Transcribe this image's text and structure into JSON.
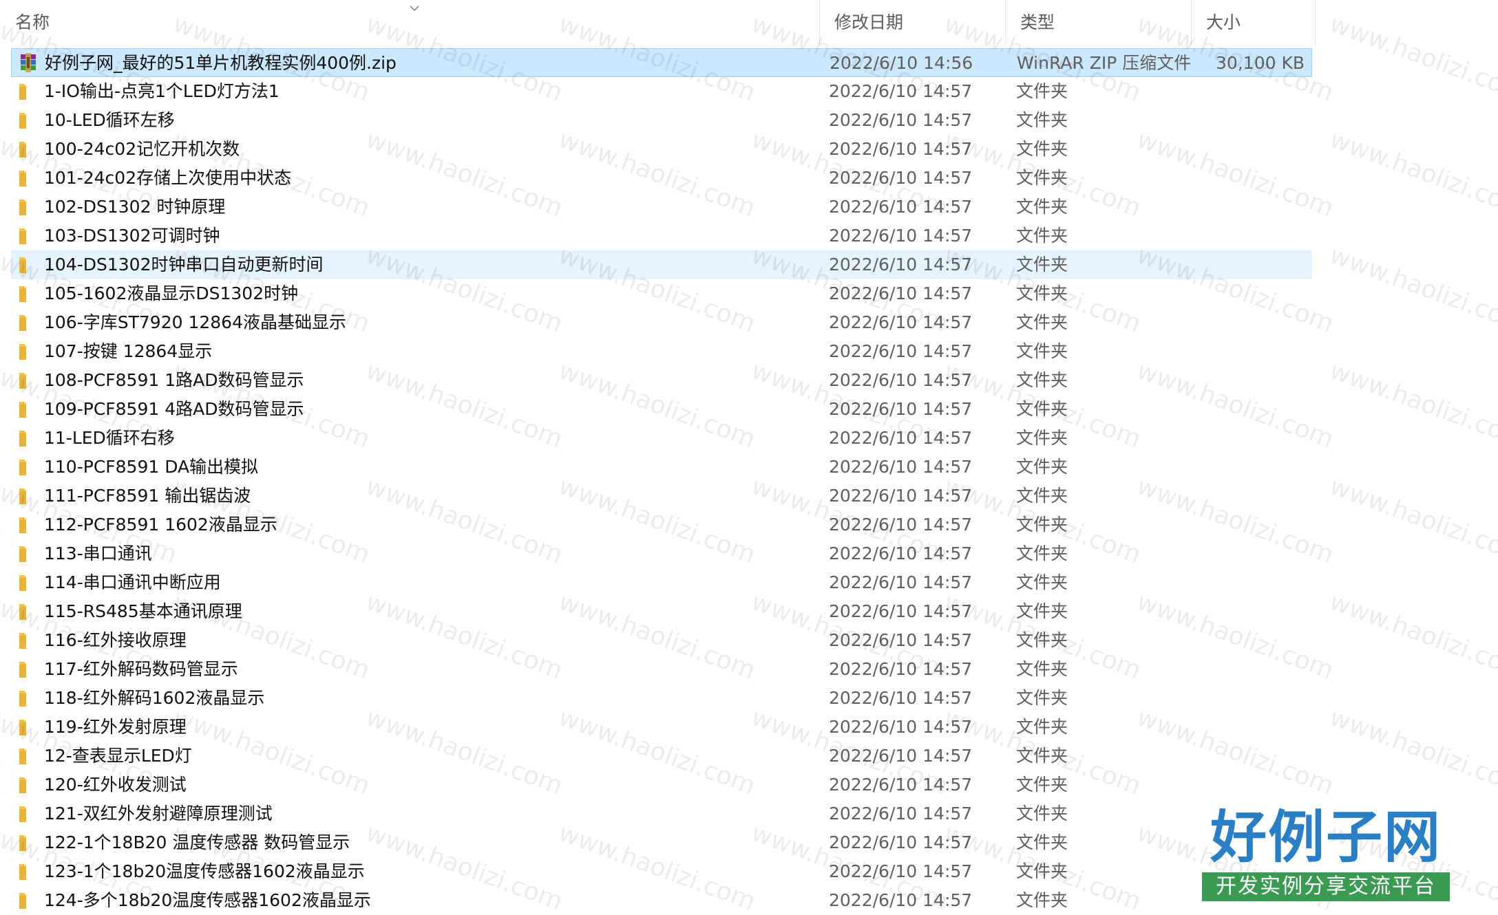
{
  "columns": {
    "name": "名称",
    "date": "修改日期",
    "type": "类型",
    "size": "大小"
  },
  "watermark": "www.haolizi.com",
  "logo": {
    "title": "好例子网",
    "subtitle": "开发实例分享交流平台"
  },
  "colors": {
    "selected_bg": "#cce8ff",
    "hover_bg": "#e5f3ff",
    "folder": "#f2c14e",
    "logo_blue": "#2a7fc4",
    "logo_green": "#3a9a52"
  },
  "files": [
    {
      "name": "好例子网_最好的51单片机教程实例400例.zip",
      "date": "2022/6/10 14:56",
      "type": "WinRAR ZIP 压缩文件",
      "size": "30,100 KB",
      "icon": "winrar-zip-icon",
      "state": "selected"
    },
    {
      "name": "1-IO输出-点亮1个LED灯方法1",
      "date": "2022/6/10 14:57",
      "type": "文件夹",
      "size": "",
      "icon": "folder-icon",
      "state": ""
    },
    {
      "name": "10-LED循环左移",
      "date": "2022/6/10 14:57",
      "type": "文件夹",
      "size": "",
      "icon": "folder-icon",
      "state": ""
    },
    {
      "name": "100-24c02记忆开机次数",
      "date": "2022/6/10 14:57",
      "type": "文件夹",
      "size": "",
      "icon": "folder-icon",
      "state": ""
    },
    {
      "name": "101-24c02存储上次使用中状态",
      "date": "2022/6/10 14:57",
      "type": "文件夹",
      "size": "",
      "icon": "folder-icon",
      "state": ""
    },
    {
      "name": "102-DS1302 时钟原理",
      "date": "2022/6/10 14:57",
      "type": "文件夹",
      "size": "",
      "icon": "folder-icon",
      "state": ""
    },
    {
      "name": "103-DS1302可调时钟",
      "date": "2022/6/10 14:57",
      "type": "文件夹",
      "size": "",
      "icon": "folder-icon",
      "state": ""
    },
    {
      "name": "104-DS1302时钟串口自动更新时间",
      "date": "2022/6/10 14:57",
      "type": "文件夹",
      "size": "",
      "icon": "folder-icon",
      "state": "hover"
    },
    {
      "name": "105-1602液晶显示DS1302时钟",
      "date": "2022/6/10 14:57",
      "type": "文件夹",
      "size": "",
      "icon": "folder-icon",
      "state": ""
    },
    {
      "name": "106-字库ST7920 12864液晶基础显示",
      "date": "2022/6/10 14:57",
      "type": "文件夹",
      "size": "",
      "icon": "folder-icon",
      "state": ""
    },
    {
      "name": "107-按键 12864显示",
      "date": "2022/6/10 14:57",
      "type": "文件夹",
      "size": "",
      "icon": "folder-icon",
      "state": ""
    },
    {
      "name": "108-PCF8591 1路AD数码管显示",
      "date": "2022/6/10 14:57",
      "type": "文件夹",
      "size": "",
      "icon": "folder-icon",
      "state": ""
    },
    {
      "name": "109-PCF8591 4路AD数码管显示",
      "date": "2022/6/10 14:57",
      "type": "文件夹",
      "size": "",
      "icon": "folder-icon",
      "state": ""
    },
    {
      "name": "11-LED循环右移",
      "date": "2022/6/10 14:57",
      "type": "文件夹",
      "size": "",
      "icon": "folder-icon",
      "state": ""
    },
    {
      "name": "110-PCF8591 DA输出模拟",
      "date": "2022/6/10 14:57",
      "type": "文件夹",
      "size": "",
      "icon": "folder-icon",
      "state": ""
    },
    {
      "name": "111-PCF8591 输出锯齿波",
      "date": "2022/6/10 14:57",
      "type": "文件夹",
      "size": "",
      "icon": "folder-icon",
      "state": ""
    },
    {
      "name": "112-PCF8591 1602液晶显示",
      "date": "2022/6/10 14:57",
      "type": "文件夹",
      "size": "",
      "icon": "folder-icon",
      "state": ""
    },
    {
      "name": "113-串口通讯",
      "date": "2022/6/10 14:57",
      "type": "文件夹",
      "size": "",
      "icon": "folder-icon",
      "state": ""
    },
    {
      "name": "114-串口通讯中断应用",
      "date": "2022/6/10 14:57",
      "type": "文件夹",
      "size": "",
      "icon": "folder-icon",
      "state": ""
    },
    {
      "name": "115-RS485基本通讯原理",
      "date": "2022/6/10 14:57",
      "type": "文件夹",
      "size": "",
      "icon": "folder-icon",
      "state": ""
    },
    {
      "name": "116-红外接收原理",
      "date": "2022/6/10 14:57",
      "type": "文件夹",
      "size": "",
      "icon": "folder-icon",
      "state": ""
    },
    {
      "name": "117-红外解码数码管显示",
      "date": "2022/6/10 14:57",
      "type": "文件夹",
      "size": "",
      "icon": "folder-icon",
      "state": ""
    },
    {
      "name": "118-红外解码1602液晶显示",
      "date": "2022/6/10 14:57",
      "type": "文件夹",
      "size": "",
      "icon": "folder-icon",
      "state": ""
    },
    {
      "name": "119-红外发射原理",
      "date": "2022/6/10 14:57",
      "type": "文件夹",
      "size": "",
      "icon": "folder-icon",
      "state": ""
    },
    {
      "name": "12-查表显示LED灯",
      "date": "2022/6/10 14:57",
      "type": "文件夹",
      "size": "",
      "icon": "folder-icon",
      "state": ""
    },
    {
      "name": "120-红外收发测试",
      "date": "2022/6/10 14:57",
      "type": "文件夹",
      "size": "",
      "icon": "folder-icon",
      "state": ""
    },
    {
      "name": "121-双红外发射避障原理测试",
      "date": "2022/6/10 14:57",
      "type": "文件夹",
      "size": "",
      "icon": "folder-icon",
      "state": ""
    },
    {
      "name": "122-1个18B20 温度传感器 数码管显示",
      "date": "2022/6/10 14:57",
      "type": "文件夹",
      "size": "",
      "icon": "folder-icon",
      "state": ""
    },
    {
      "name": "123-1个18b20温度传感器1602液晶显示",
      "date": "2022/6/10 14:57",
      "type": "文件夹",
      "size": "",
      "icon": "folder-icon",
      "state": ""
    },
    {
      "name": "124-多个18b20温度传感器1602液晶显示",
      "date": "2022/6/10 14:57",
      "type": "文件夹",
      "size": "",
      "icon": "folder-icon",
      "state": ""
    }
  ]
}
